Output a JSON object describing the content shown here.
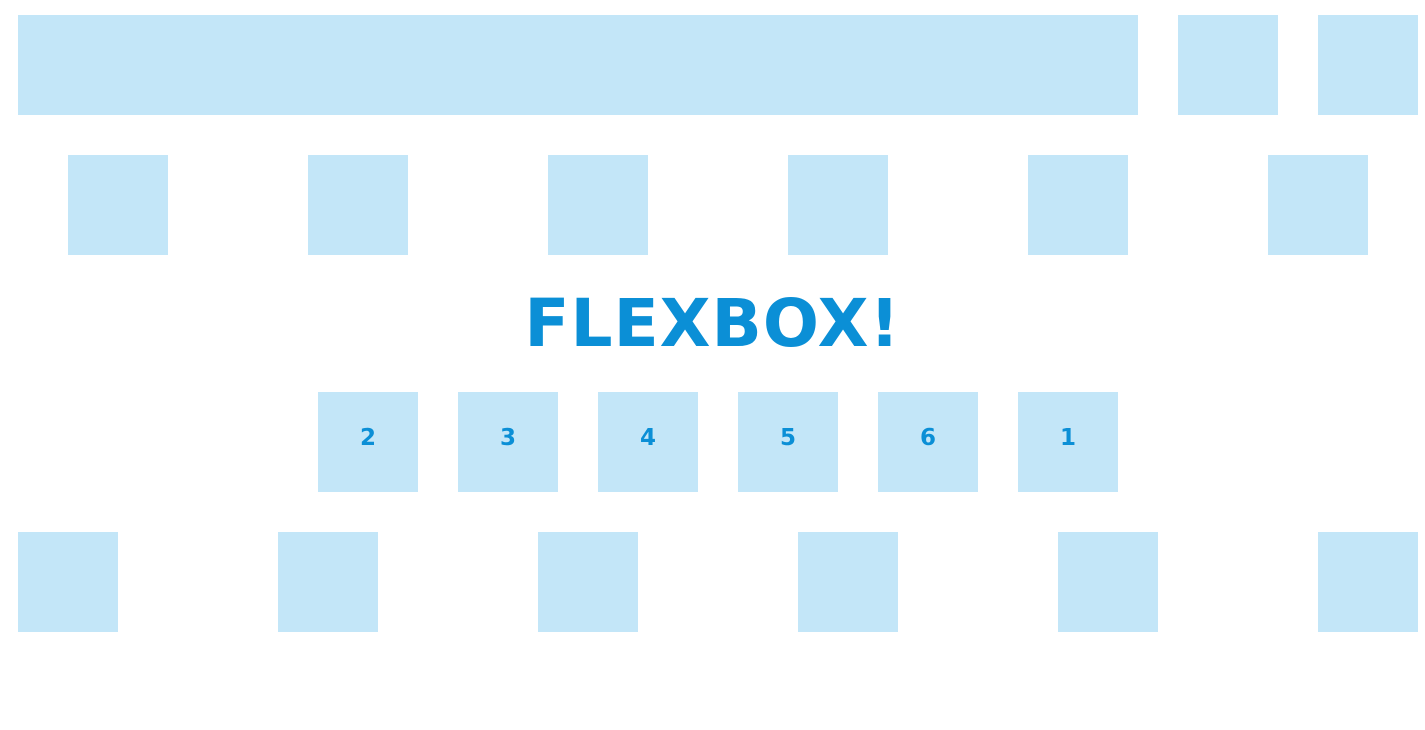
{
  "colors": {
    "box_fill": "#c3e6f8",
    "accent": "#0b8fd6",
    "background": "#ffffff"
  },
  "title": "FLEXBOX!",
  "ordered_row": {
    "items": [
      "2",
      "3",
      "4",
      "5",
      "6",
      "1"
    ]
  }
}
